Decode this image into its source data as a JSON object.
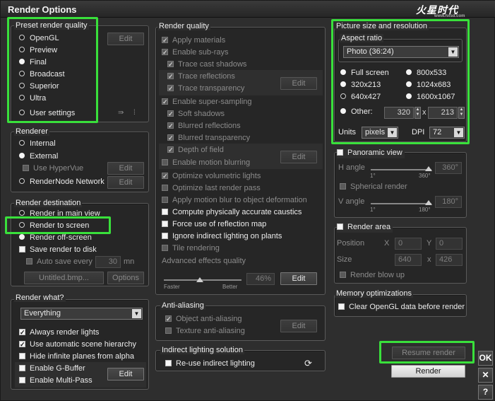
{
  "window": {
    "title": "Render Options",
    "logo": "火星时代",
    "logo_sub": "www.hxsd.com"
  },
  "preset": {
    "title": "Preset render quality",
    "options": [
      "OpenGL",
      "Preview",
      "Final",
      "Broadcast",
      "Superior",
      "Ultra",
      "User settings"
    ],
    "selected": "Final",
    "edit": "Edit"
  },
  "renderer": {
    "title": "Renderer",
    "internal": "Internal",
    "external": "External",
    "use_hypervue": "Use HyperVue",
    "rendernode": "RenderNode Network",
    "edit": "Edit"
  },
  "destination": {
    "title": "Render destination",
    "main_view": "Render in main view",
    "to_screen": "Render to screen",
    "off_screen": "Render off-screen",
    "save_disk": "Save render to disk",
    "auto_save": "Auto save every",
    "auto_save_value": "30",
    "auto_save_unit": "mn",
    "filename": "Untitled.bmp...",
    "options": "Options"
  },
  "render_what": {
    "title": "Render what?",
    "selected": "Everything",
    "always_lights": "Always render lights",
    "auto_hierarchy": "Use automatic scene hierarchy",
    "hide_planes": "Hide infinite planes from alpha",
    "gbuffer": "Enable G-Buffer",
    "multipass": "Enable Multi-Pass",
    "edit": "Edit"
  },
  "quality": {
    "title": "Render quality",
    "apply_materials": "Apply materials",
    "enable_subrays": "Enable sub-rays",
    "trace_shadows": "Trace cast shadows",
    "trace_reflections": "Trace reflections",
    "trace_transparency": "Trace transparency",
    "enable_supersampling": "Enable super-sampling",
    "soft_shadows": "Soft shadows",
    "blurred_reflections": "Blurred reflections",
    "blurred_transparency": "Blurred transparency",
    "depth_of_field": "Depth of field",
    "motion_blurring": "Enable motion blurring",
    "volumetric_lights": "Optimize volumetric lights",
    "last_render_pass": "Optimize last render pass",
    "motion_blur_deform": "Apply motion blur to object deformation",
    "caustics": "Compute physically accurate caustics",
    "reflection_map": "Force use of reflection map",
    "ignore_indirect": "Ignore indirect lighting on plants",
    "tile_rendering": "Tile rendering",
    "advanced_quality": "Advanced effects quality",
    "faster": "Faster",
    "better": "Better",
    "quality_value": "46%",
    "edit": "Edit"
  },
  "antialiasing": {
    "title": "Anti-aliasing",
    "object_aa": "Object anti-aliasing",
    "texture_aa": "Texture anti-aliasing",
    "edit": "Edit"
  },
  "indirect": {
    "title": "Indirect lighting solution",
    "reuse": "Re-use indirect lighting"
  },
  "picture": {
    "title": "Picture size and resolution",
    "aspect_label": "Aspect ratio",
    "aspect_value": "Photo (36:24)",
    "full_screen": "Full screen",
    "r800": "800x533",
    "r320": "320x213",
    "r1024": "1024x683",
    "r640": "640x427",
    "r1600": "1600x1067",
    "other": "Other:",
    "width": "320",
    "height": "213",
    "x": "x",
    "units_label": "Units",
    "units_value": "pixels",
    "dpi_label": "DPI",
    "dpi_value": "72"
  },
  "panoramic": {
    "title": "Panoramic view",
    "h_angle": "H angle",
    "h_value": "360°",
    "spherical": "Spherical render",
    "v_angle": "V angle",
    "v_value": "180°",
    "h_min": "1°",
    "h_max": "360°",
    "v_min": "1°",
    "v_max": "180°"
  },
  "render_area": {
    "title": "Render area",
    "position": "Position",
    "x_label": "X",
    "x_value": "0",
    "y_label": "Y",
    "y_value": "0",
    "size": "Size",
    "w_value": "640",
    "x": "x",
    "h_value": "426",
    "blow_up": "Render blow up"
  },
  "memory": {
    "title": "Memory optimizations",
    "clear_opengl": "Clear OpenGL data before render"
  },
  "actions": {
    "resume": "Resume render",
    "render": "Render",
    "ok": "OK",
    "close": "✕",
    "help": "?"
  }
}
